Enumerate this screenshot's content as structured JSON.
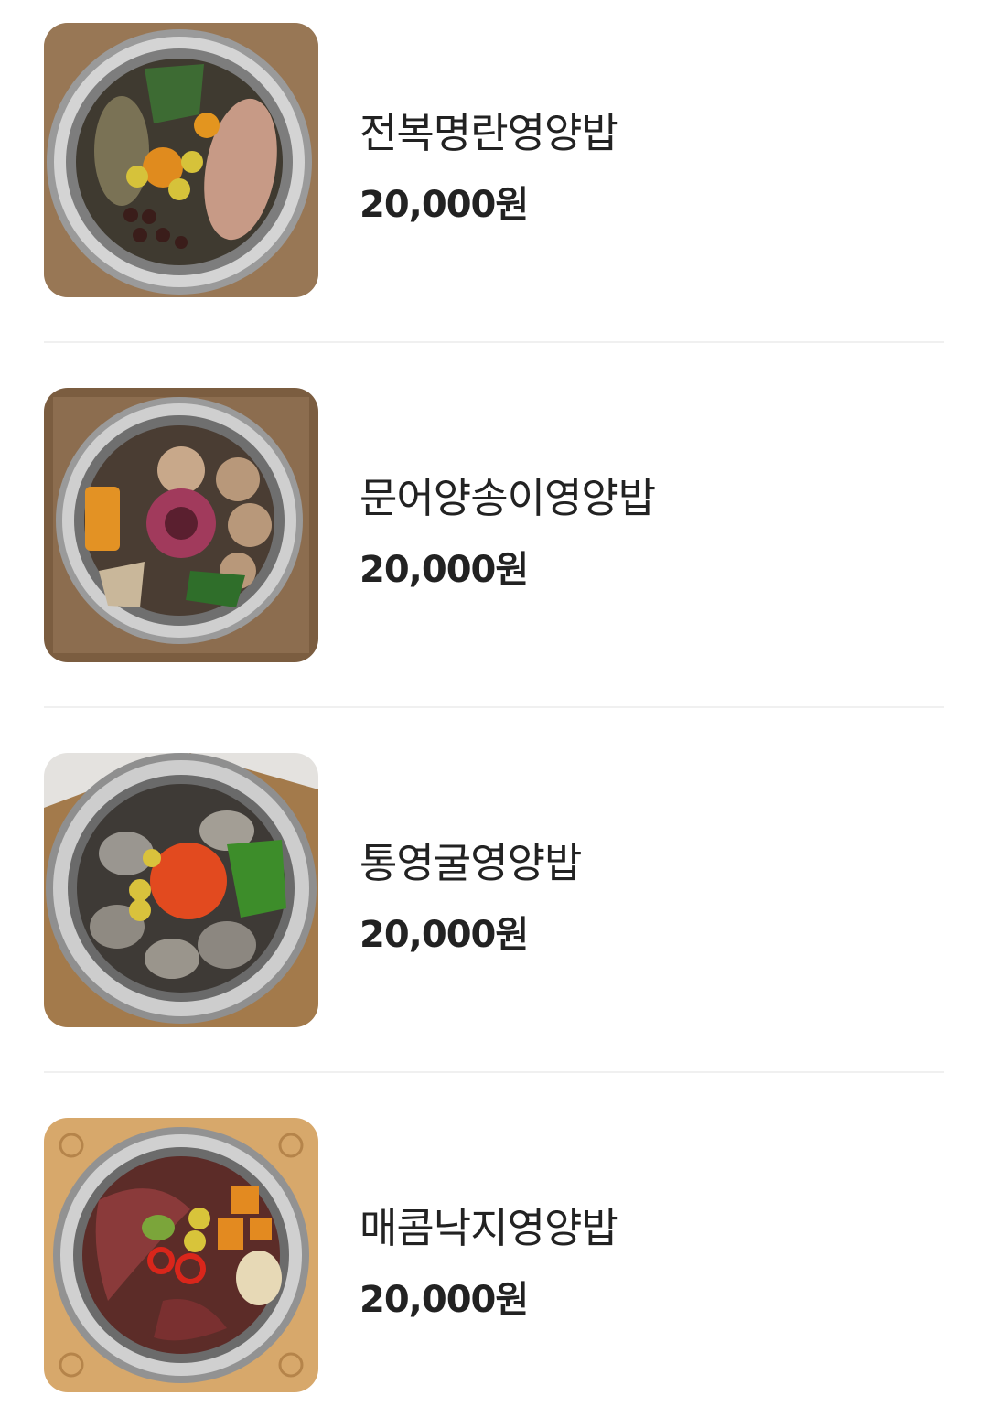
{
  "menu": {
    "items": [
      {
        "name": "전복명란영양밥",
        "price": "20,000원",
        "image": "abalone-pollock-roe-rice-pot"
      },
      {
        "name": "문어양송이영양밥",
        "price": "20,000원",
        "image": "octopus-mushroom-rice-pot"
      },
      {
        "name": "통영굴영양밥",
        "price": "20,000원",
        "image": "tongyeong-oyster-rice-pot"
      },
      {
        "name": "매콤낙지영양밥",
        "price": "20,000원",
        "image": "spicy-small-octopus-rice-pot"
      }
    ]
  },
  "colors": {
    "text": "#222222",
    "divider": "#f0f0f0",
    "wood": "#8a6a4a",
    "pot_steel": "#b8b8b8"
  }
}
